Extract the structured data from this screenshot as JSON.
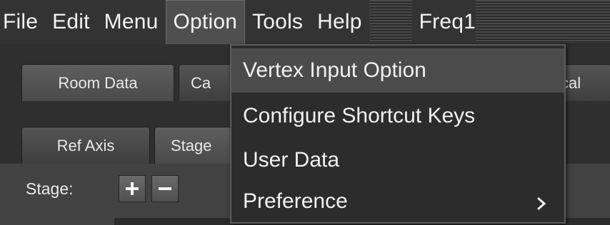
{
  "menubar": {
    "items": [
      "File",
      "Edit",
      "Menu",
      "Option",
      "Tools",
      "Help",
      "Freq1"
    ]
  },
  "tabs_top": [
    "Room Data",
    "Ca",
    "cal"
  ],
  "tabs_second": [
    "Ref Axis",
    "Stage"
  ],
  "panel": {
    "stage_label": "Stage:",
    "add_icon": "plus-icon",
    "remove_icon": "minus-icon"
  },
  "option_menu": {
    "items": [
      "Vertex Input Option",
      "Configure Shortcut Keys",
      "User Data",
      "Preference"
    ],
    "submenu_icon": "chevron-right-icon"
  },
  "colors": {
    "background": "#3a3a3a",
    "menu_highlight": "#4b4b4b",
    "text": "#f1f1f1"
  }
}
